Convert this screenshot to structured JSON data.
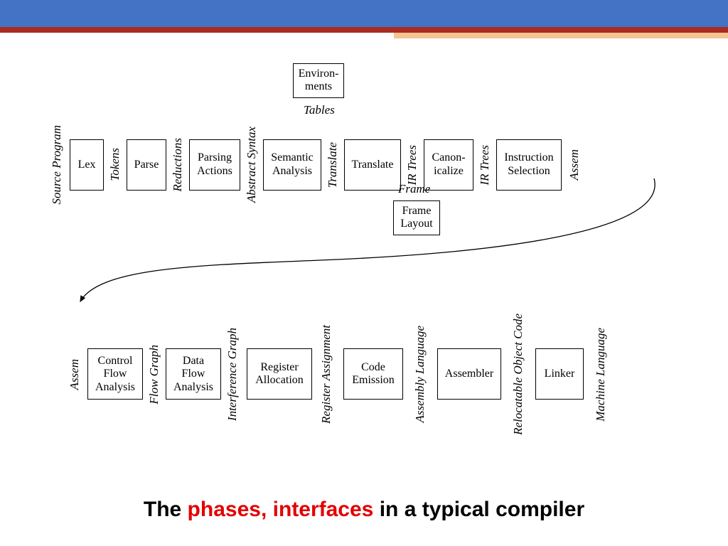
{
  "header": {},
  "row1_labels": {
    "l0": "Source Program",
    "l1": "Tokens",
    "l2": "Reductions",
    "l3": "Abstract Syntax",
    "l4": "Translate",
    "l5": "IR Trees",
    "l6": "IR Trees",
    "l7": "Assem"
  },
  "row1_boxes": {
    "b0": "Lex",
    "b1": "Parse",
    "b2_a": "Parsing",
    "b2_b": "Actions",
    "b3_a": "Semantic",
    "b3_b": "Analysis",
    "b4": "Translate",
    "b5_a": "Canon-",
    "b5_b": "icalize",
    "b6_a": "Instruction",
    "b6_b": "Selection"
  },
  "aux": {
    "env_a": "Environ-",
    "env_b": "ments",
    "tables_label": "Tables",
    "frame_label": "Frame",
    "frame_a": "Frame",
    "frame_b": "Layout"
  },
  "row2_labels": {
    "l0": "Assem",
    "l1": "Flow Graph",
    "l2": "Interference Graph",
    "l3": "Register Assignment",
    "l4": "Assembly Language",
    "l5": "Relocatable Object Code",
    "l6": "Machine Language"
  },
  "row2_boxes": {
    "b0_a": "Control",
    "b0_b": "Flow",
    "b0_c": "Analysis",
    "b1_a": "Data",
    "b1_b": "Flow",
    "b1_c": "Analysis",
    "b2_a": "Register",
    "b2_b": "Allocation",
    "b3_a": "Code",
    "b3_b": "Emission",
    "b4": "Assembler",
    "b5": "Linker"
  },
  "caption": {
    "t1": "The ",
    "t2": "phases",
    "t3": ", ",
    "t4": "interfaces",
    "t5": "  in a typical compiler"
  }
}
